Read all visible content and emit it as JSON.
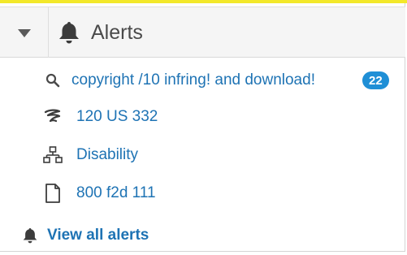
{
  "header": {
    "title": "Alerts",
    "collapse_icon": "caret-down-icon",
    "title_icon": "bell-icon"
  },
  "alerts": [
    {
      "icon": "search-icon",
      "label": "copyright /10 infring! and download!",
      "badge": "22"
    },
    {
      "icon": "signature-icon",
      "label": "120 US 332"
    },
    {
      "icon": "network-tree-icon",
      "label": "Disability"
    },
    {
      "icon": "document-icon",
      "label": "800 f2d 111"
    }
  ],
  "footer": {
    "view_all_label": "View all alerts",
    "icon": "bell-icon"
  },
  "colors": {
    "accent_bar": "#f3e82a",
    "link": "#1e73b4",
    "badge": "#1f8fd6"
  }
}
